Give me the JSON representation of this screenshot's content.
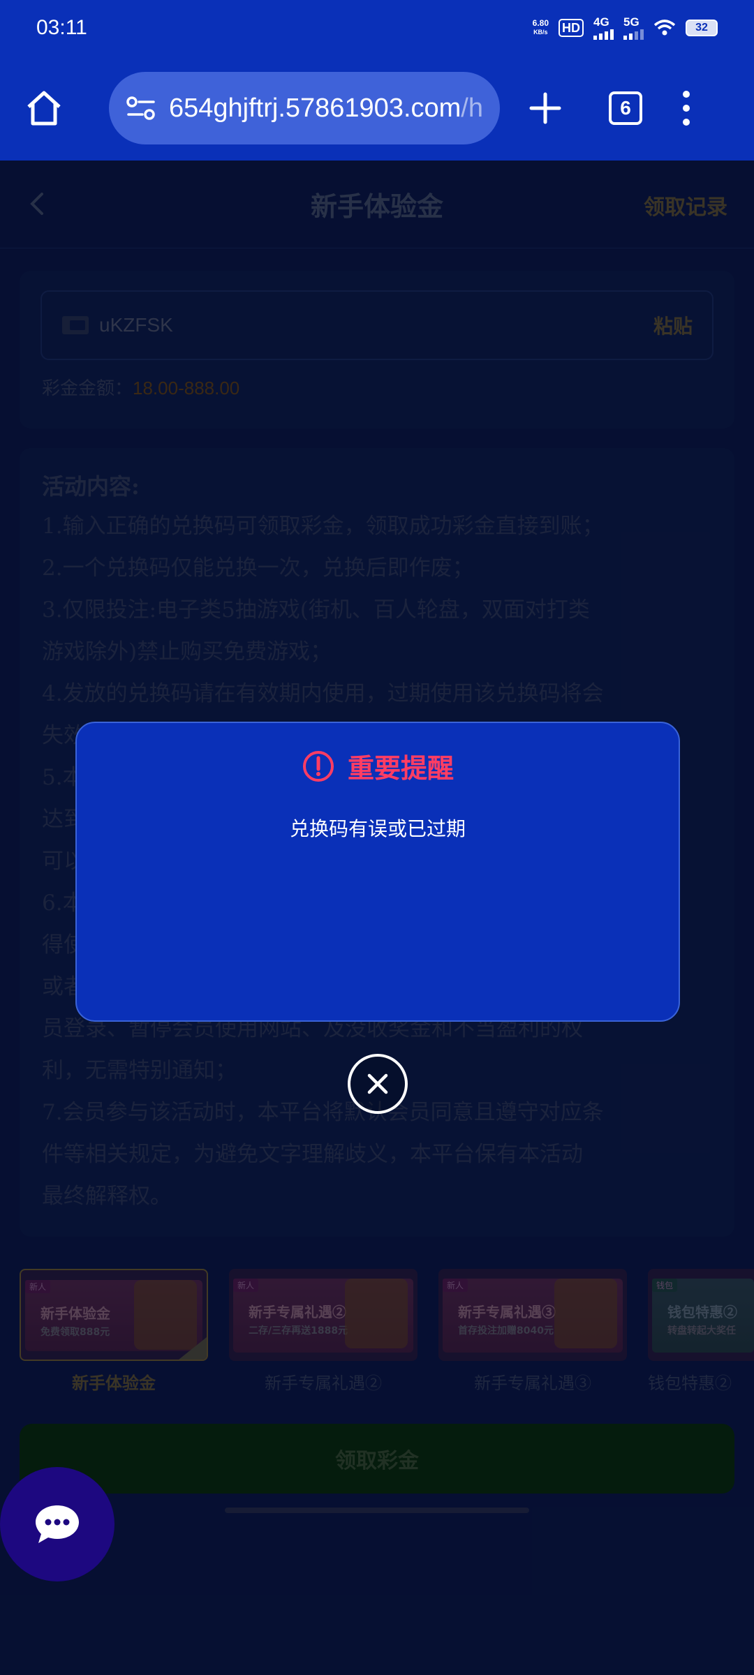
{
  "status_bar": {
    "time": "03:11",
    "net_speed_value": "6.80",
    "net_speed_unit": "KB/s",
    "hd_badge": "HD",
    "signal_1": "4G",
    "signal_2": "5G",
    "battery": "32"
  },
  "browser": {
    "url_main": "654ghjftrj.57861903.com",
    "url_rest": "/h",
    "tab_count": "6"
  },
  "header": {
    "title": "新手体验金",
    "records_link": "领取记录"
  },
  "code_card": {
    "code_value": "uKZFSK",
    "paste_label": "粘贴",
    "amount_label": "彩金金额：",
    "amount_value": "18.00-888.00"
  },
  "rules": {
    "title": "活动内容:",
    "lines": [
      "1.输入正确的兑换码可领取彩金，领取成功彩金直接到账；",
      "2.一个兑换码仅能兑换一次，兑换后即作废；",
      "3.仅限投注:电子类5抽游戏(街机、百人轮盘，双面对打类",
      "游戏除外)禁止购买免费游戏；",
      "4.发放的兑换码请在有效期内使用，过期使用该兑换码将会",
      "失效",
      "5.本",
      "达到",
      "可以",
      "6.本",
      "得使",
      "或者",
      "员登录、暂停会员使用网站、及没收奖金和不当盈利的权",
      "利，无需特别通知；",
      "7.会员参与该活动时，本平台将默认会员同意且遵守对应条",
      "件等相关规定，为避免文字理解歧义，本平台保有本活动",
      "最终解释权。"
    ]
  },
  "promos": [
    {
      "tag": "新人",
      "title": "新手体验金",
      "subtitle": "免费领取888元",
      "label": "新手体验金"
    },
    {
      "tag": "新人",
      "title": "新手专属礼遇②",
      "subtitle": "二存/三存再送1888元",
      "label": "新手专属礼遇②"
    },
    {
      "tag": "新人",
      "title": "新手专属礼遇③",
      "subtitle": "首存投注加赠8040元",
      "label": "新手专属礼遇③"
    },
    {
      "tag": "钱包",
      "title": "钱包特惠②",
      "subtitle": "转盘转起大奖任",
      "label": "钱包特惠②"
    }
  ],
  "claim_button": "领取彩金",
  "dialog": {
    "title": "重要提醒",
    "message": "兑换码有误或已过期"
  },
  "colors": {
    "brand_blue": "#0a30b8",
    "dialog_title": "#ff3d63",
    "page_bg": "#0b1d52"
  },
  "icons": {
    "home": "home-icon",
    "site_settings": "site-settings-icon",
    "plus": "plus-icon",
    "tabs": "tabs-icon",
    "menu": "more-menu-icon",
    "back": "back-chevron-icon",
    "ticket": "ticket-icon",
    "alert": "alert-circle-icon",
    "close": "close-circle-icon",
    "chat": "chat-bubble-icon"
  }
}
